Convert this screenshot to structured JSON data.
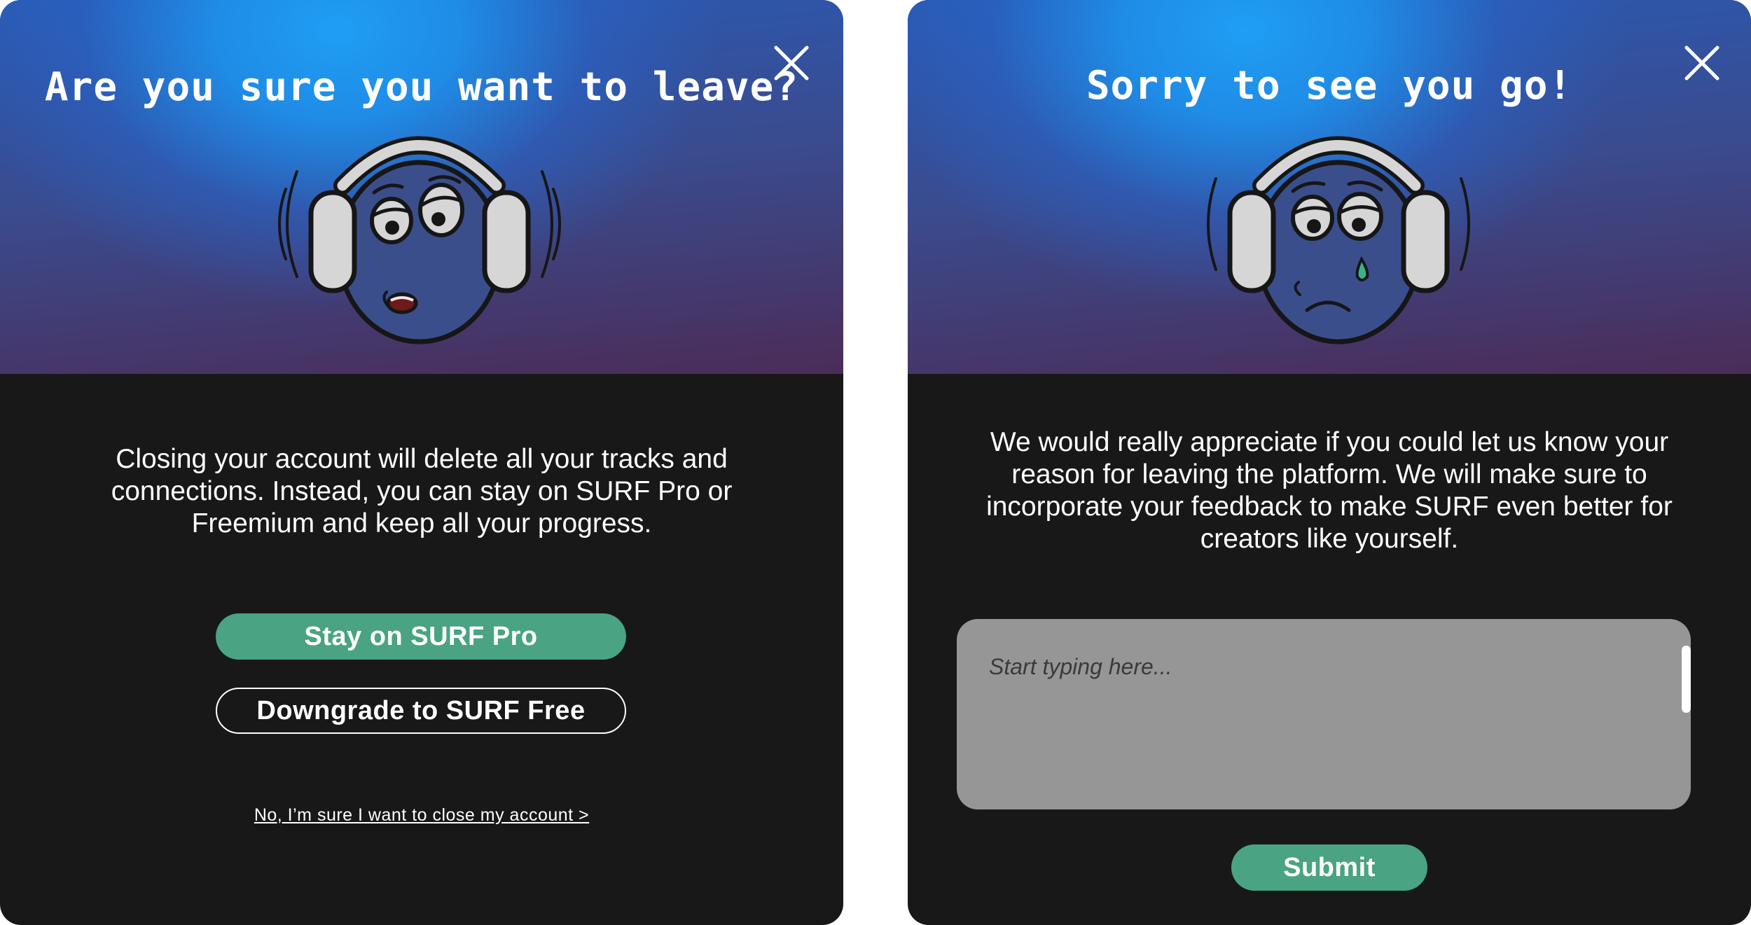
{
  "leave_modal": {
    "title": "Are you sure you want to leave?",
    "close_icon": "close-icon",
    "mascot": "worried-headphones-face",
    "message": "Closing your account will delete all your tracks and connections. Instead, you can stay on SURF Pro or Freemium and keep all your progress.",
    "stay_button": "Stay on SURF Pro",
    "downgrade_button": "Downgrade to SURF Free",
    "close_account_link": "No, I’m sure I want to close my account >"
  },
  "feedback_modal": {
    "title": "Sorry to see you go!",
    "close_icon": "close-icon",
    "mascot": "crying-headphones-face",
    "message": "We would really appreciate if you could let us know your reason for leaving the platform. We will make sure to incorporate your feedback to make  SURF even better for creators like yourself.",
    "feedback_placeholder": "Start typing here...",
    "submit_button": "Submit"
  },
  "colors": {
    "panel_background": "#181818",
    "accent_green": "#4aa383",
    "hero_blue": "#1f9ef5",
    "hero_purple": "#4b2c58",
    "textarea_gray": "#969696",
    "tear_green": "#3bb38a"
  }
}
